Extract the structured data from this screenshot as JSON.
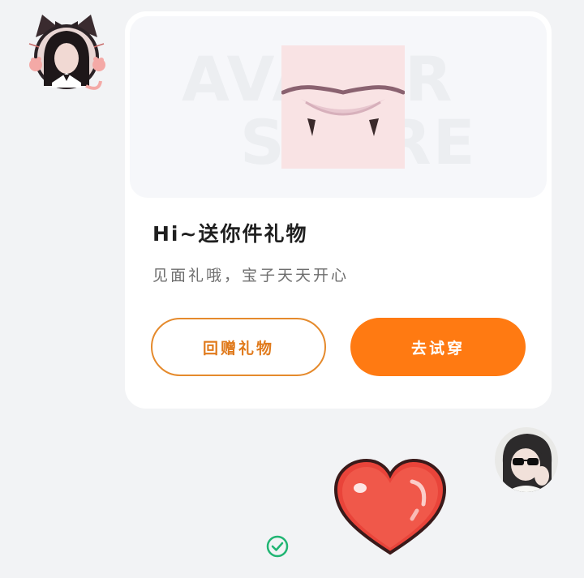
{
  "gift_card": {
    "watermark_line1": "AVATAR",
    "watermark_line2": "STORE",
    "item_image": "vampire-fangs-mouth-image",
    "title": "Hi~送你件礼物",
    "subtitle": "见面礼哦，宝子天天开心",
    "return_gift_label": "回赠礼物",
    "try_on_label": "去试穿"
  },
  "sticker": "red-heart-icon",
  "status": {
    "read_icon": "check-circle-icon"
  },
  "colors": {
    "accent": "#ff7a12",
    "accent_outline": "#e58a2c",
    "check": "#21b573",
    "background": "#f2f3f5",
    "card": "#ffffff"
  }
}
